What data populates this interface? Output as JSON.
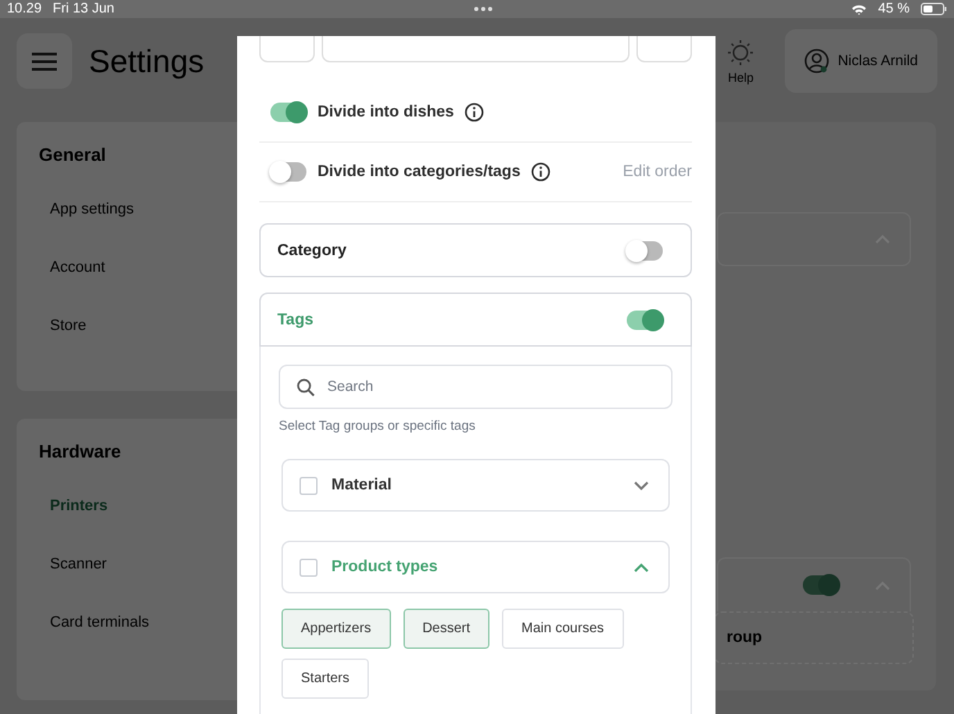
{
  "status_bar": {
    "time": "10.29",
    "date": "Fri 13 Jun",
    "battery": "45 %"
  },
  "background": {
    "title": "Settings",
    "help": "Help",
    "user": "Niclas Arnild",
    "sidebar": [
      {
        "title": "General",
        "items": [
          {
            "label": "App settings",
            "selected": false
          },
          {
            "label": "Account",
            "selected": false
          },
          {
            "label": "Store",
            "selected": false
          }
        ]
      },
      {
        "title": "Hardware",
        "items": [
          {
            "label": "Printers",
            "selected": true
          },
          {
            "label": "Scanner",
            "selected": false
          },
          {
            "label": "Card terminals",
            "selected": false
          }
        ]
      }
    ],
    "panel": {
      "cards": [
        {
          "kind": "collapsible",
          "expanded": true
        },
        {
          "kind": "toggle",
          "on": true,
          "expanded": true
        }
      ],
      "group_label": "roup"
    }
  },
  "modal": {
    "options": [
      {
        "label": "Divide into dishes",
        "on": true
      },
      {
        "label": "Divide into categories/tags",
        "on": false,
        "action": "Edit order"
      }
    ],
    "sections": [
      {
        "title": "Category",
        "on": false
      },
      {
        "title": "Tags",
        "on": true
      }
    ],
    "search": {
      "placeholder": "Search"
    },
    "hint": "Select Tag groups or specific tags",
    "groups": [
      {
        "name": "Material",
        "checked": false,
        "expanded": false
      },
      {
        "name": "Product types",
        "checked": false,
        "expanded": true
      }
    ],
    "chips": [
      {
        "label": "Appertizers",
        "selected": true
      },
      {
        "label": "Dessert",
        "selected": true
      },
      {
        "label": "Main courses",
        "selected": false
      },
      {
        "label": "Starters",
        "selected": false
      }
    ]
  }
}
